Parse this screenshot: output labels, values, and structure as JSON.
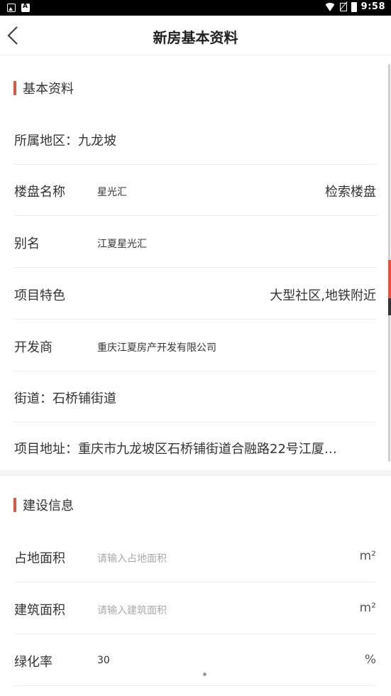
{
  "status_bar": {
    "time": "9:58"
  },
  "nav": {
    "title": "新房基本资料"
  },
  "sections": {
    "basic": {
      "title": "基本资料",
      "district": "所属地区：九龙坡",
      "estate": {
        "label": "楼盘名称",
        "value": "星光汇",
        "action": "检索楼盘"
      },
      "alias": {
        "label": "别名",
        "value": "江夏星光汇"
      },
      "features": {
        "label": "项目特色",
        "value": "大型社区,地铁附近"
      },
      "developer": {
        "label": "开发商",
        "value": "重庆江夏房产开发有限公司"
      },
      "street": "街道：石桥铺街道",
      "address": "项目地址：重庆市九龙坡区石桥铺街道合融路22号江厦…"
    },
    "construction": {
      "title": "建设信息",
      "land_area": {
        "label": "占地面积",
        "placeholder": "请输入占地面积",
        "unit": "m²"
      },
      "building_area": {
        "label": "建筑面积",
        "placeholder": "请输入建筑面积",
        "unit": "m²"
      },
      "green_rate": {
        "label": "绿化率",
        "value": "30",
        "unit": "%"
      }
    }
  }
}
